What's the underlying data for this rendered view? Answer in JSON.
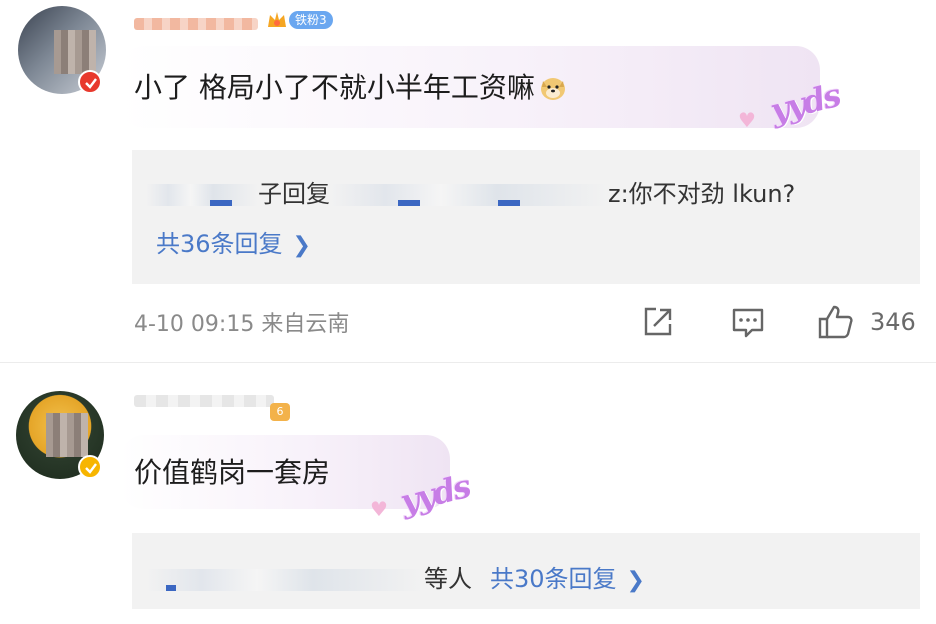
{
  "comments": [
    {
      "fan_badge": "铁粉3",
      "text": "小了 格局小了不就小半年工资嘛",
      "emoji": "doge-emoji",
      "sticker": "yyds",
      "reply_preview": {
        "prefix": "子回复",
        "suffix": "z:你不对劲 lkun?"
      },
      "more_replies": "共36条回复",
      "time_location": "4-10 09:15 来自云南",
      "likes": "346"
    },
    {
      "level_badge": "6",
      "text": "价值鹤岗一套房",
      "sticker": "yyds",
      "reply_preview": {
        "suffix": "等人"
      },
      "more_replies": "共30条回复"
    }
  ],
  "icons": [
    "share-icon",
    "comment-icon",
    "like-icon",
    "chevron-right-icon",
    "crown-icon",
    "verified-check-icon"
  ],
  "colors": {
    "link": "#4a79c8",
    "fan_badge": "#6aa7f0",
    "sticker": "#c77de6",
    "reply_bg": "#f2f2f2"
  }
}
